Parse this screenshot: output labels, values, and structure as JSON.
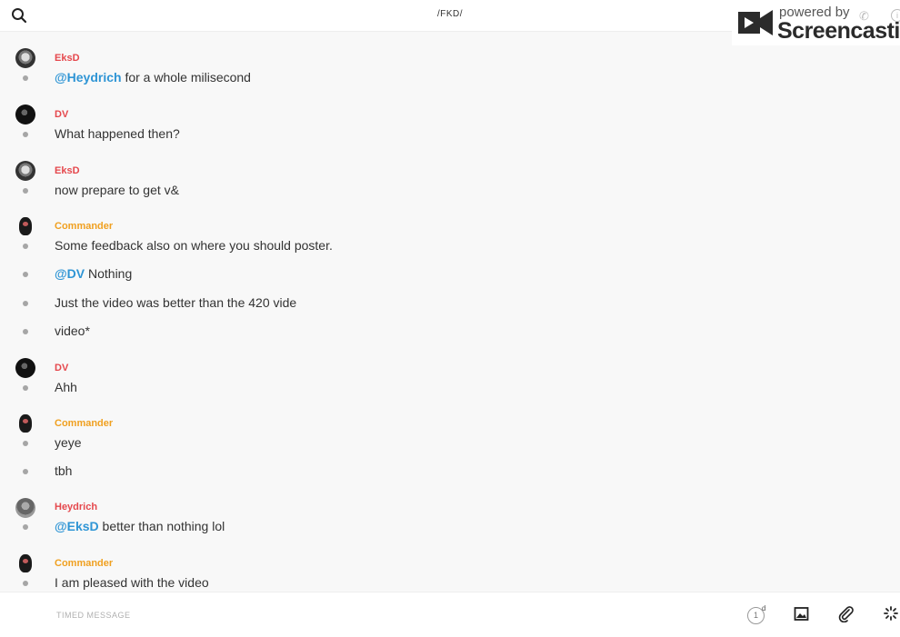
{
  "header": {
    "channel_title": "/FKD/",
    "search_icon": "search-icon"
  },
  "watermark": {
    "powered": "powered by",
    "brand": "Screencastify"
  },
  "messages": [
    {
      "author": "EksD",
      "avatar": "EksD avatar",
      "author_color": "#e5484d",
      "lines": [
        {
          "mention": "@Heydrich",
          "text": " for a whole milisecond"
        }
      ]
    },
    {
      "author": "DV",
      "avatar": "DV avatar",
      "author_color": "#e5484d",
      "lines": [
        {
          "mention": "",
          "text": "What happened then?"
        }
      ]
    },
    {
      "author": "EksD",
      "avatar": "EksD avatar",
      "author_color": "#e5484d",
      "lines": [
        {
          "mention": "",
          "text": "now prepare to get v&"
        }
      ]
    },
    {
      "author": "Commander",
      "avatar": "Commander avatar",
      "author_color": "#f0a020",
      "lines": [
        {
          "mention": "",
          "text": "Some feedback also on where you should poster."
        },
        {
          "mention": "@DV",
          "text": " Nothing"
        },
        {
          "mention": "",
          "text": "Just the video was better than the 420 vide"
        },
        {
          "mention": "",
          "text": "video*"
        }
      ]
    },
    {
      "author": "DV",
      "avatar": "DV avatar",
      "author_color": "#e5484d",
      "lines": [
        {
          "mention": "",
          "text": "Ahh"
        }
      ]
    },
    {
      "author": "Commander",
      "avatar": "Commander avatar",
      "author_color": "#f0a020",
      "lines": [
        {
          "mention": "",
          "text": "yeye"
        },
        {
          "mention": "",
          "text": "tbh"
        }
      ]
    },
    {
      "author": "Heydrich",
      "avatar": "Heydrich avatar",
      "author_color": "#e5484d",
      "lines": [
        {
          "mention": "@EksD",
          "text": " better than nothing lol"
        }
      ]
    },
    {
      "author": "Commander",
      "avatar": "Commander avatar",
      "author_color": "#f0a020",
      "lines": [
        {
          "mention": "",
          "text": "I am pleased with the video"
        }
      ]
    }
  ],
  "composer": {
    "placeholder": "TIMED MESSAGE",
    "timer_value": "1",
    "timer_unit": "d",
    "icons": [
      "image-icon",
      "paperclip-icon",
      "sparkle-icon"
    ]
  },
  "colors": {
    "mention": "#2f95d5",
    "author_red": "#e5484d",
    "author_orange": "#f0a020"
  }
}
